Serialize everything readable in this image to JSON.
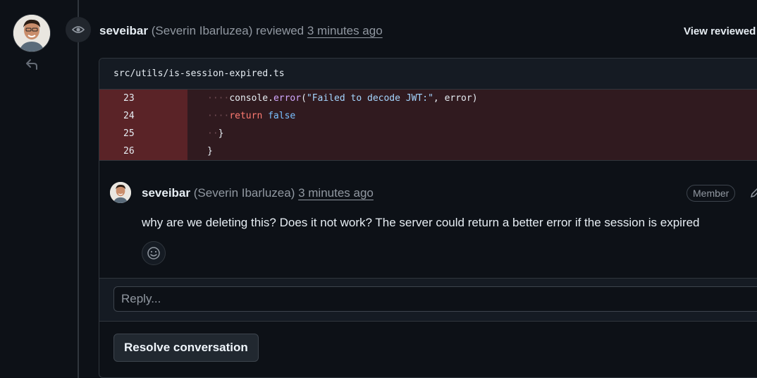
{
  "review": {
    "author": "seveibar",
    "full_name": "(Severin Ibarluzea)",
    "action": "reviewed",
    "time": "3 minutes ago",
    "view_reviewed": "View reviewed"
  },
  "file": {
    "path": "src/utils/is-session-expired.ts"
  },
  "code_lines": [
    {
      "num": "23"
    },
    {
      "num": "24"
    },
    {
      "num": "25"
    },
    {
      "num": "26"
    }
  ],
  "code_tokens": {
    "l23_ws": "····",
    "l23_obj": "console.",
    "l23_fn": "error",
    "l23_open": "(",
    "l23_str": "\"Failed to decode JWT:\"",
    "l23_rest": ", error)",
    "l24_ws": "····",
    "l24_kw": "return",
    "l24_sp": " ",
    "l24_bool": "false",
    "l25_ws": "··",
    "l25_brace": "}",
    "l26_brace": "}"
  },
  "comment": {
    "author": "seveibar",
    "full_name": "(Severin Ibarluzea)",
    "time": "3 minutes ago",
    "badge": "Member",
    "body": "why are we deleting this? Does it not work? The server could return a better error if the session is expired"
  },
  "reply": {
    "placeholder": "Reply..."
  },
  "resolve_label": "Resolve conversation",
  "icons": {
    "eye": "eye-icon",
    "reply": "reply-icon",
    "smiley": "smiley-icon",
    "pencil": "pencil-icon"
  }
}
